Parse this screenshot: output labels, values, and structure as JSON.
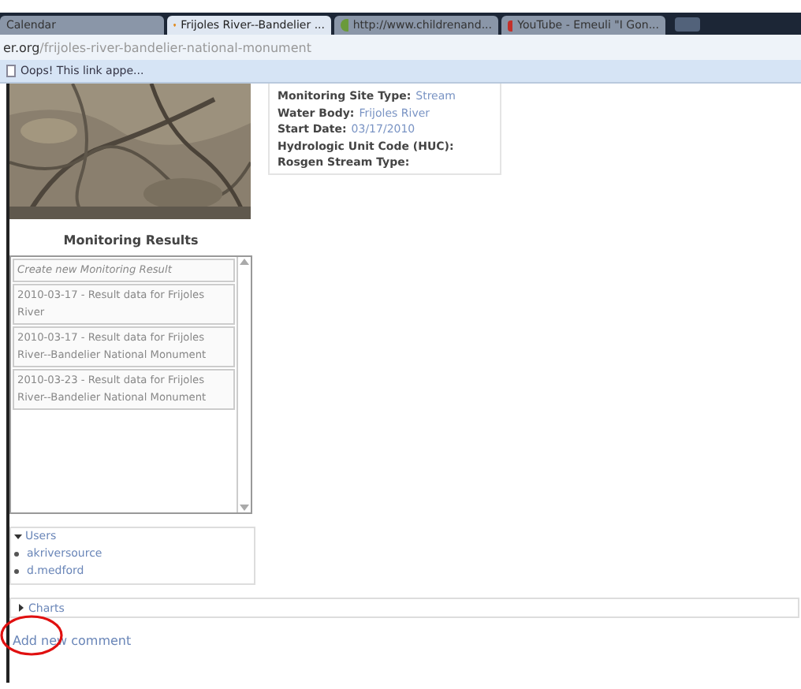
{
  "tabs": [
    {
      "label": "Calendar",
      "selected": false
    },
    {
      "label": "Frijoles River--Bandelier ...",
      "selected": true
    },
    {
      "label": "http://www.childrenand...",
      "selected": false
    },
    {
      "label": "YouTube - Emeuli \"I Gon...",
      "selected": false
    }
  ],
  "address": {
    "domain": "er.org",
    "path": "/frijoles-river-bandelier-national-monument"
  },
  "bookmarks": [
    "Oops! This link appe..."
  ],
  "site_info": [
    {
      "label": "Monitoring Site Type:",
      "value": "Stream"
    },
    {
      "label": "Water Body:",
      "value": "Frijoles River"
    },
    {
      "label": "Start Date:",
      "value": "03/17/2010"
    },
    {
      "label": "Hydrologic Unit Code (HUC):"
    },
    {
      "label": "Rosgen Stream Type:"
    }
  ],
  "map": {
    "kind": "picture"
  },
  "monitoring_results": {
    "title": "Monitoring Results",
    "items": [
      {
        "text": "Create new Monitoring Result",
        "kind": "create"
      },
      {
        "text": "2010-03-17 - Result data for Frijoles River",
        "kind": "result"
      },
      {
        "text": "2010-03-17 - Result data for Frijoles River--Bandelier National Monument",
        "kind": "result"
      },
      {
        "text": "2010-03-23 - Result data for Frijoles River--Bandelier National Monument",
        "kind": "result"
      }
    ]
  },
  "users": {
    "title": "Users",
    "expanded": true,
    "items": [
      "akriversource",
      "d.medford"
    ]
  },
  "charts": {
    "title": "Charts",
    "expanded": false
  },
  "add_comment": "Add new comment"
}
